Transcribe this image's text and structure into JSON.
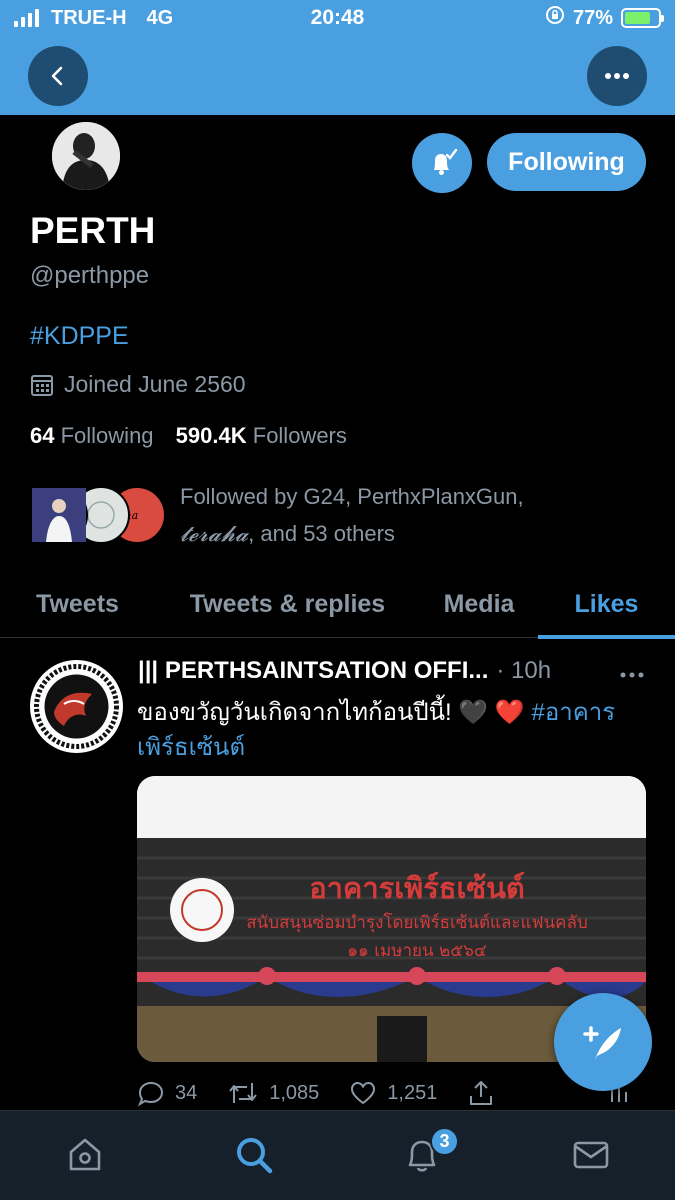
{
  "status_bar": {
    "carrier": "TRUE-H",
    "network": "4G",
    "time": "20:48",
    "battery": "77%",
    "battery_fraction": 0.77
  },
  "header": {
    "back_icon": "chevron-left-icon",
    "more_icon": "more-horizontal-icon"
  },
  "profile": {
    "name": "PERTH",
    "handle": "@perthppe",
    "bio": "#KDPPE",
    "joined": "Joined June 2560",
    "following_count": "64",
    "following_label": "Following",
    "followers_count": "590.4K",
    "followers_label": "Followers",
    "follow_button": "Following",
    "followed_by": "Followed by G24, PerthxPlanxGun,",
    "followed_by_2_name": "𝓽𝓮𝓻𝓪𝓱𝓪",
    "followed_by_2_rest": ", and 53 others"
  },
  "tabs": [
    {
      "label": "Tweets"
    },
    {
      "label": "Tweets & replies"
    },
    {
      "label": "Media"
    },
    {
      "label": "Likes"
    }
  ],
  "tweet": {
    "author": "||| PERTHSAINTSATION OFFI...",
    "time": "· 10h",
    "text": "ของขวัญวันเกิดจากไทก้อนปีนี้! 🖤 ❤️ ",
    "hashtag": "#อาคารเพิร์ธเซ้นต์",
    "sign_title": "อาคารเพิร์ธเซ้นต์",
    "sign_sub": "สนับสนุนซ่อมบำรุงโดยเพิร์ธเซ้นต์และแฟนคลับ",
    "sign_date": "๑๑ เมษายน ๒๕๖๔",
    "replies": "34",
    "retweets": "1,085",
    "likes": "1,251"
  },
  "bottom_nav": {
    "notification_badge": "3"
  },
  "colors": {
    "accent": "#4a9fe0",
    "background": "#000000",
    "muted": "#8b98a5"
  }
}
